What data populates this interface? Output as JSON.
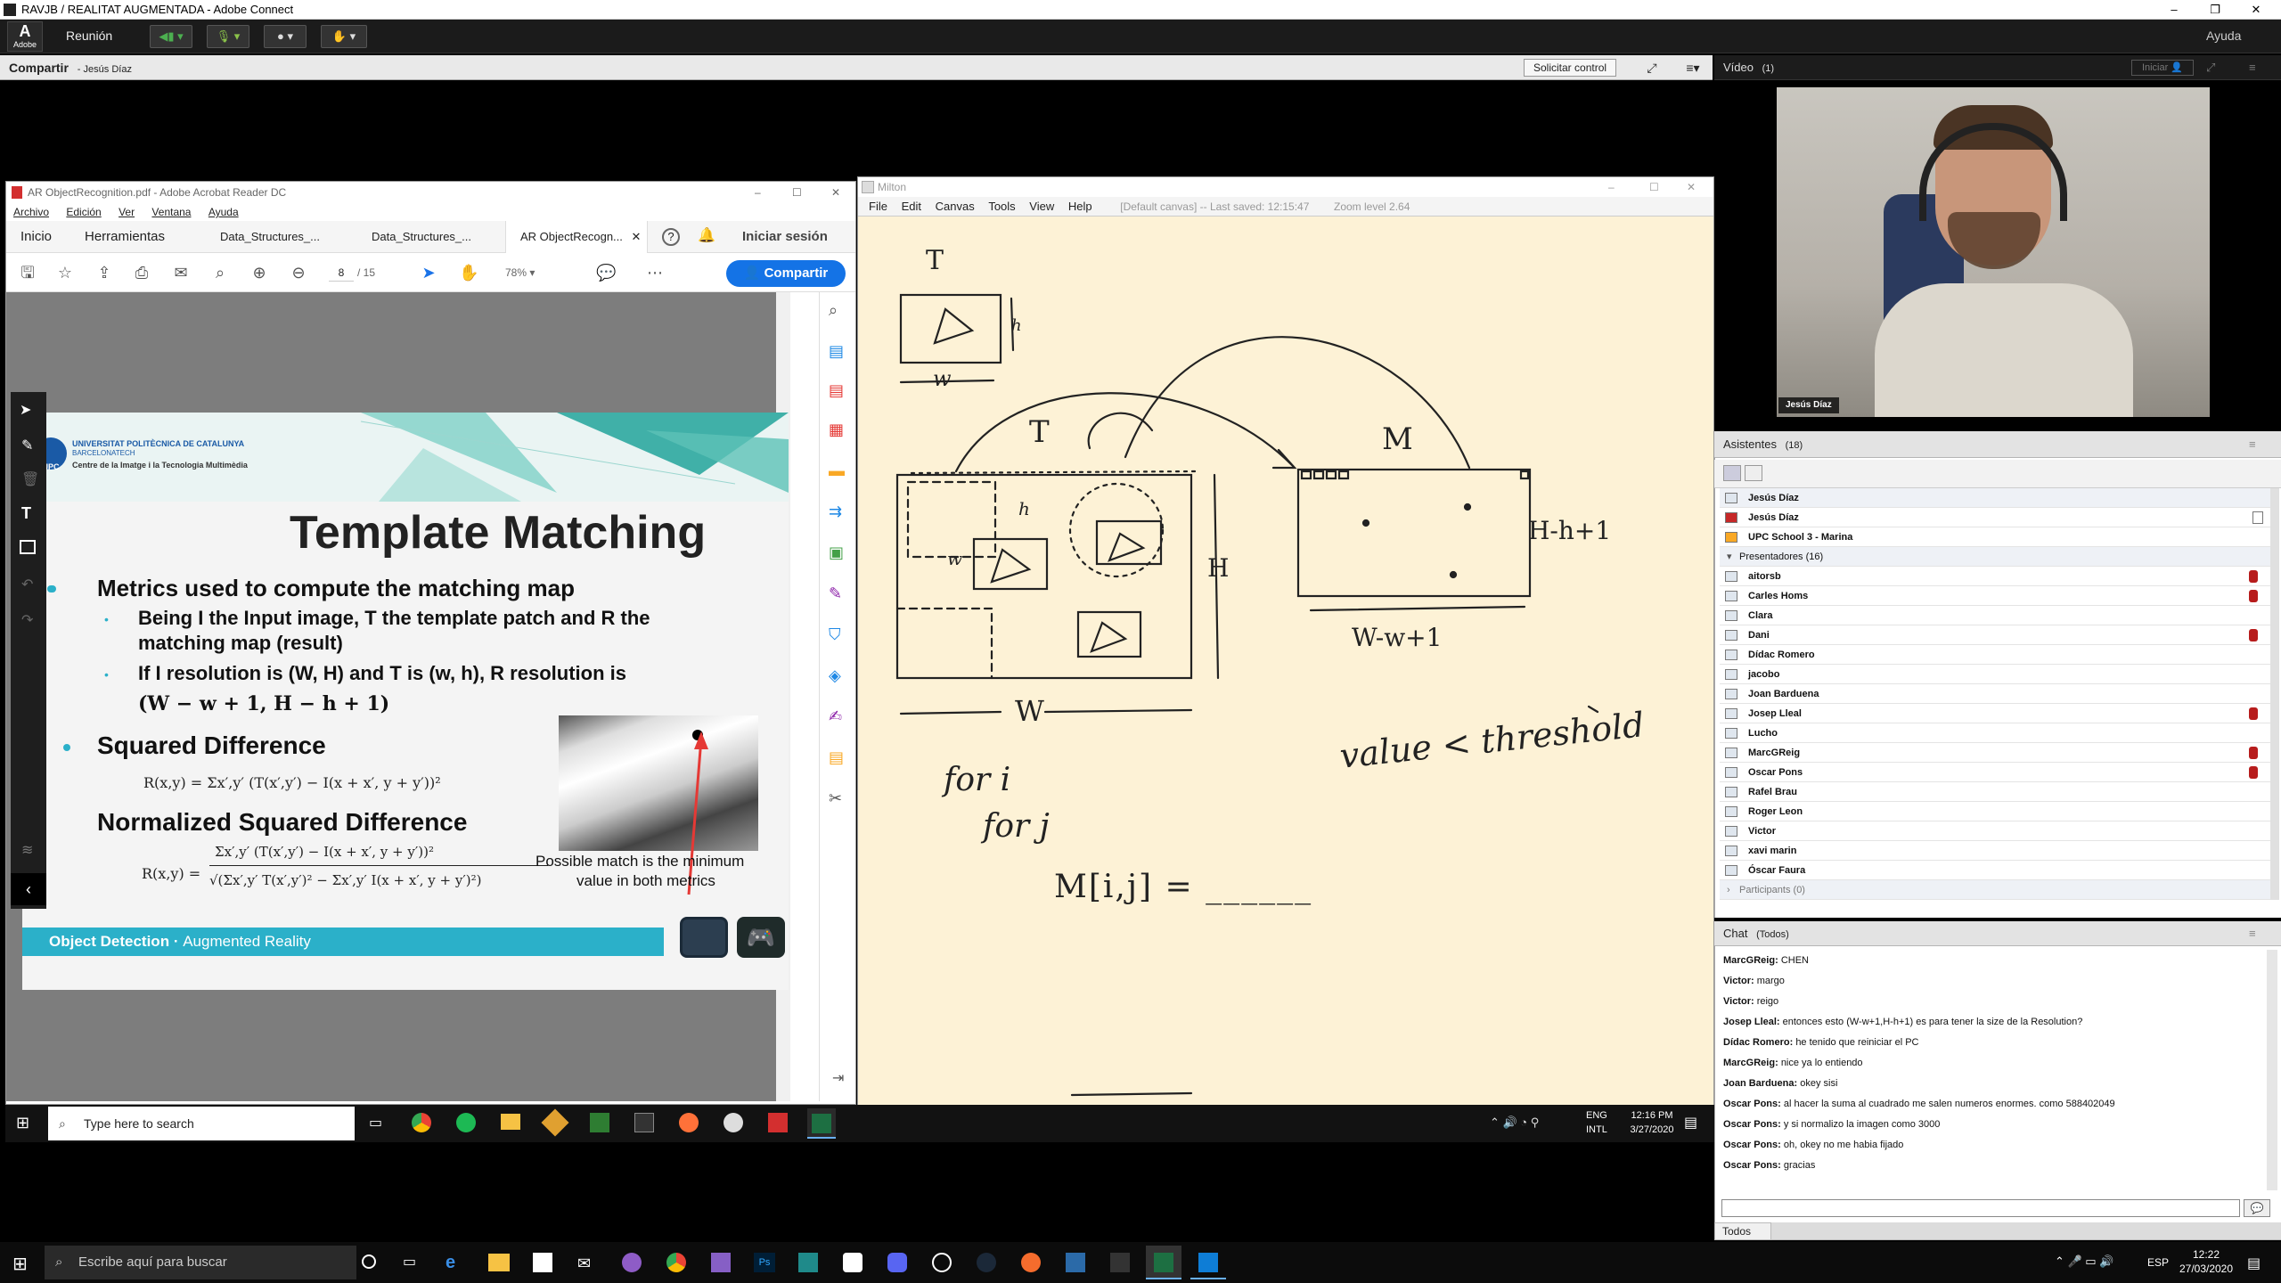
{
  "window": {
    "title": "RAVJB / REALITAT AUGMENTADA - Adobe Connect",
    "controls": [
      "–",
      "❐",
      "✕"
    ]
  },
  "connect_toolbar": {
    "logo": "Adobe",
    "meeting_menu": "Reunión",
    "help": "Ayuda"
  },
  "share_pod": {
    "title": "Compartir",
    "presenter": "Jesús Díaz",
    "request_control": "Solicitar control"
  },
  "video_pod": {
    "title": "Vídeo",
    "count": "(1)",
    "start_button": "Iniciar",
    "name_tag": "Jesús Díaz"
  },
  "acrobat": {
    "title": "AR ObjectRecognition.pdf - Adobe Acrobat Reader DC",
    "menu": [
      "Archivo",
      "Edición",
      "Ver",
      "Ventana",
      "Ayuda"
    ],
    "tabs": [
      "Inicio",
      "Herramientas",
      "Data_Structures_...",
      "Data_Structures_...",
      "AR ObjectRecogn..."
    ],
    "signin": "Iniciar sesión",
    "page_current": "8",
    "page_total": "/ 15",
    "zoom": "78%",
    "share_button": "Compartir"
  },
  "slide": {
    "university_line1": "UNIVERSITAT POLITÈCNICA DE CATALUNYA",
    "university_line2": "BARCELONATECH",
    "university_line3": "Centre de la Imatge i la Tecnologia Multimèdia",
    "upc": "UPC",
    "title": "Template Matching",
    "bullet1": "Metrics used to compute the matching map",
    "sub1a": "Being I the Input image, T the template patch and R the",
    "sub1b": "matching map (result)",
    "sub2a": "If I resolution is (W, H) and T is (w, h), R resolution is",
    "sub2b": "(W − w + 1, H − h + 1)",
    "bullet2": "Squared Difference",
    "formula1": "R(x,y) = Σx′,y′ (T(x′,y′) − I(x + x′, y + y′))²",
    "bullet3": "Normalized Squared Difference",
    "formula2_num": "Σx′,y′ (T(x′,y′) − I(x + x′, y + y′))²",
    "formula2_den": "√(Σx′,y′ T(x′,y′)² − Σx′,y′ I(x + x′, y + y′)²)",
    "formula2_lhs": "R(x,y) =",
    "caption1": "Possible match is the  minimum",
    "caption2": "value in both metrics",
    "footer_a": "Object Detection",
    "footer_sep": " · ",
    "footer_b": "Augmented Reality"
  },
  "milton": {
    "title": "Milton",
    "menu": [
      "File",
      "Edit",
      "Canvas",
      "Tools",
      "View",
      "Help"
    ],
    "status": "[Default canvas] -- Last saved: 12:15:47",
    "zoom": "Zoom level 2.64",
    "handwriting": {
      "t_label": "T",
      "w_small": "w",
      "h_small": "h",
      "t_label2": "T",
      "m_label": "M",
      "H_label": "H",
      "W_label": "W",
      "hdim": "H-h+1",
      "wdim": "W-w+1",
      "threshold": "value < threshold",
      "loop1": "for i",
      "loop2": "for j",
      "assign": "M[i,j] = ______"
    }
  },
  "inner_taskbar": {
    "search": "Type here to search",
    "lang1": "ENG",
    "lang2": "INTL",
    "time": "12:16 PM",
    "date": "3/27/2020"
  },
  "attendees": {
    "title": "Asistentes",
    "count": "(18)",
    "host_group": "Jesús Díaz",
    "hosts": [
      "Jesús Díaz",
      "UPC School 3 - Marina"
    ],
    "presenters_label": "Presentadores (16)",
    "presenters": [
      "aitorsb",
      "Carles Homs",
      "Clara",
      "Dani",
      "Dídac Romero",
      "jacobo",
      "Joan Barduena",
      "Josep Lleal",
      "Lucho",
      "MarcGReig",
      "Oscar Pons",
      "Rafel Brau",
      "Roger Leon",
      "Victor",
      "xavi marin",
      "Óscar Faura"
    ],
    "participants_label": "Participants (0)"
  },
  "chat": {
    "title": "Chat",
    "scope": "(Todos)",
    "messages": [
      {
        "who": "MarcGReig:",
        "text": "CHEN"
      },
      {
        "who": "Victor:",
        "text": "margo"
      },
      {
        "who": "Victor:",
        "text": "reigo"
      },
      {
        "who": "Josep Lleal:",
        "text": "entonces esto (W-w+1,H-h+1) es para tener la size de la Resolution?"
      },
      {
        "who": "Dídac Romero:",
        "text": "he tenido que reiniciar el PC"
      },
      {
        "who": "MarcGReig:",
        "text": "nice ya lo entiendo"
      },
      {
        "who": "Joan Barduena:",
        "text": "okey sisi"
      },
      {
        "who": "Oscar Pons:",
        "text": "al hacer la suma al cuadrado me salen numeros enormes. como 588402049"
      },
      {
        "who": "Oscar Pons:",
        "text": "y si normalizo la imagen como 3000"
      },
      {
        "who": "Oscar Pons:",
        "text": "oh, okey no me habia fijado"
      },
      {
        "who": "Oscar Pons:",
        "text": "gracias"
      }
    ],
    "recipient": "Todos"
  },
  "outer_taskbar": {
    "search": "Escribe aquí para buscar",
    "lang": "ESP",
    "time": "12:22",
    "date": "27/03/2020"
  }
}
